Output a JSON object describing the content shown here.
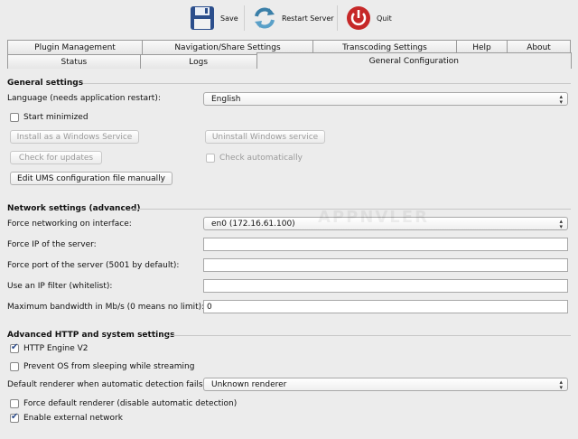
{
  "toolbar": {
    "save_label": "Save",
    "restart_label": "Restart Server",
    "quit_label": "Quit"
  },
  "tabs": {
    "row1": [
      "Plugin Management",
      "Navigation/Share Settings",
      "Transcoding Settings",
      "Help",
      "About"
    ],
    "row2": [
      "Status",
      "Logs",
      "General Configuration"
    ]
  },
  "general": {
    "title": "General settings",
    "language_label": "Language (needs application restart):",
    "language_value": "English",
    "start_minimized": "Start minimized",
    "install_service": "Install as a Windows Service",
    "uninstall_service": "Uninstall Windows service",
    "check_updates": "Check for updates",
    "check_automatically": "Check automatically",
    "edit_conf": "Edit UMS configuration file manually"
  },
  "network": {
    "title": "Network settings (advanced)",
    "force_interface_label": "Force networking on interface:",
    "force_interface_value": "en0 (172.16.61.100)",
    "force_ip_label": "Force IP of the server:",
    "force_ip_value": "",
    "force_port_label": "Force port of the server (5001 by default):",
    "force_port_value": "",
    "ip_filter_label": "Use an IP filter (whitelist):",
    "ip_filter_value": "",
    "bandwidth_label": "Maximum bandwidth in Mb/s (0 means no limit):",
    "bandwidth_value": "0"
  },
  "advanced": {
    "title": "Advanced HTTP and system settings",
    "http_engine": "HTTP Engine V2",
    "http_engine_checked": true,
    "prevent_sleep": "Prevent OS from sleeping while streaming",
    "prevent_sleep_checked": false,
    "default_renderer_label": "Default renderer when automatic detection fails:",
    "default_renderer_value": "Unknown renderer",
    "force_renderer": "Force default renderer (disable automatic detection)",
    "force_renderer_checked": false,
    "external_network": "Enable external network",
    "external_network_checked": true
  },
  "colors": {
    "background": "#ececec",
    "save_icon": "#2b4e8c",
    "restart_icon": "#3a7fa8",
    "quit_icon": "#c62828"
  }
}
